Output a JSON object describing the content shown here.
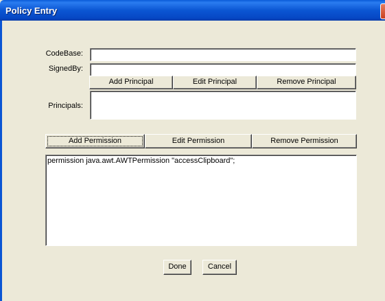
{
  "window": {
    "title": "Policy Entry"
  },
  "form": {
    "codebase_label": "CodeBase:",
    "codebase_value": "",
    "signedby_label": "SignedBy:",
    "signedby_value": "",
    "principals_label": "Principals:"
  },
  "principal_buttons": {
    "add": "Add Principal",
    "edit": "Edit Principal",
    "remove": "Remove Principal"
  },
  "permission_buttons": {
    "add": "Add Permission",
    "edit": "Edit Permission",
    "remove": "Remove Permission"
  },
  "permissions": [
    "permission java.awt.AWTPermission \"accessClipboard\";"
  ],
  "dialog_buttons": {
    "done": "Done",
    "cancel": "Cancel"
  }
}
